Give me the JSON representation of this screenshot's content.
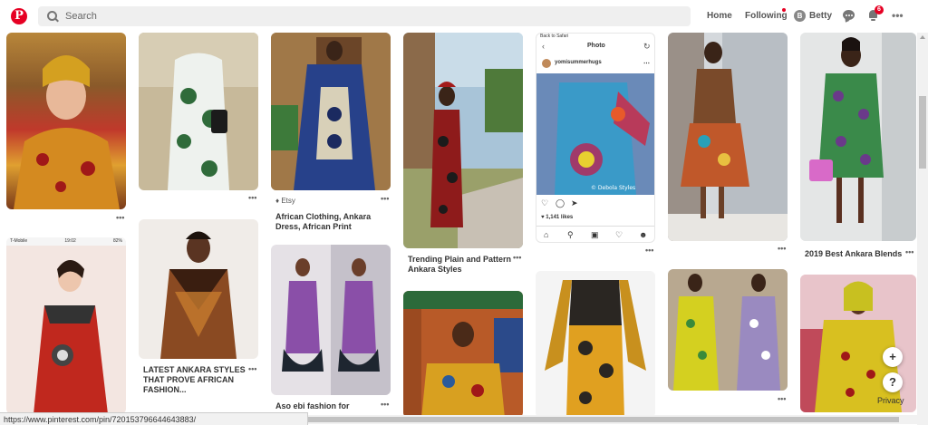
{
  "header": {
    "logo": "P",
    "search_placeholder": "Search",
    "home": "Home",
    "following": "Following",
    "avatar_initial": "B",
    "user": "Betty",
    "notifications_count": "6",
    "more": "•••"
  },
  "pins": [
    {
      "id": "p1",
      "caption": "",
      "more": "•••"
    },
    {
      "id": "p2",
      "caption": "",
      "more": "•••"
    },
    {
      "id": "p3",
      "etsy": "Etsy",
      "caption1": "African Clothing, Ankara",
      "caption2": "Dress, African Print",
      "more": "•••"
    },
    {
      "id": "p4",
      "caption1": "Trending Plain and Pattern",
      "caption2": "Ankara Styles",
      "more": "•••"
    },
    {
      "id": "p5",
      "back": "Back to Safari",
      "title": "Photo",
      "handle": "yomisummerhugs",
      "likes": "1,141 likes",
      "watermark": "© Debola Styles",
      "more": "•••"
    },
    {
      "id": "p6",
      "more": "•••"
    },
    {
      "id": "p7",
      "caption1": "2019 Best Ankara Blends",
      "more": "•••"
    },
    {
      "id": "p8",
      "carrier": "T-Mobile",
      "time": "19:02",
      "battery": "82%"
    },
    {
      "id": "p9",
      "caption1": "LATEST ANKARA STYLES",
      "caption2": "THAT PROVE AFRICAN",
      "caption3": "FASHION...",
      "more": "•••"
    },
    {
      "id": "p10",
      "caption1": "Aso ebi fashion for",
      "more": "•••"
    },
    {
      "id": "p13",
      "more": "•••"
    }
  ],
  "fab_plus": "+",
  "fab_help": "?",
  "privacy": "Privacy",
  "status_url": "https://www.pinterest.com/pin/720153796644643883/"
}
